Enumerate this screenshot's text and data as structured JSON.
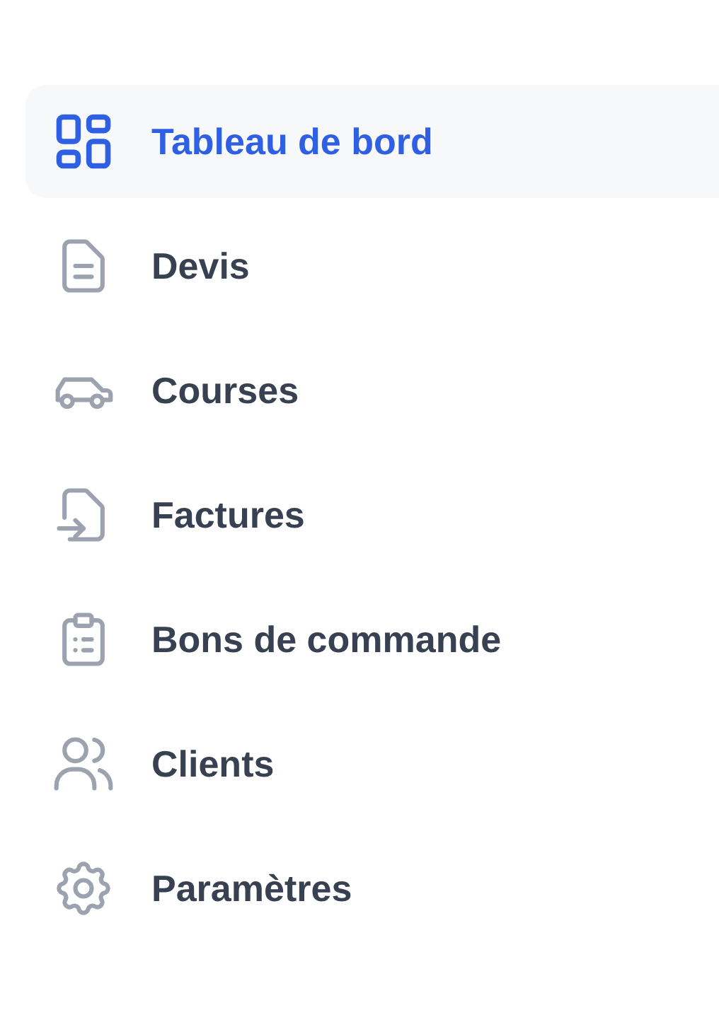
{
  "sidebar": {
    "items": [
      {
        "label": "Tableau de bord",
        "selected": true
      },
      {
        "label": "Devis",
        "selected": false
      },
      {
        "label": "Courses",
        "selected": false
      },
      {
        "label": "Factures",
        "selected": false
      },
      {
        "label": "Bons de commande",
        "selected": false
      },
      {
        "label": "Clients",
        "selected": false
      },
      {
        "label": "Paramètres",
        "selected": false
      }
    ]
  }
}
